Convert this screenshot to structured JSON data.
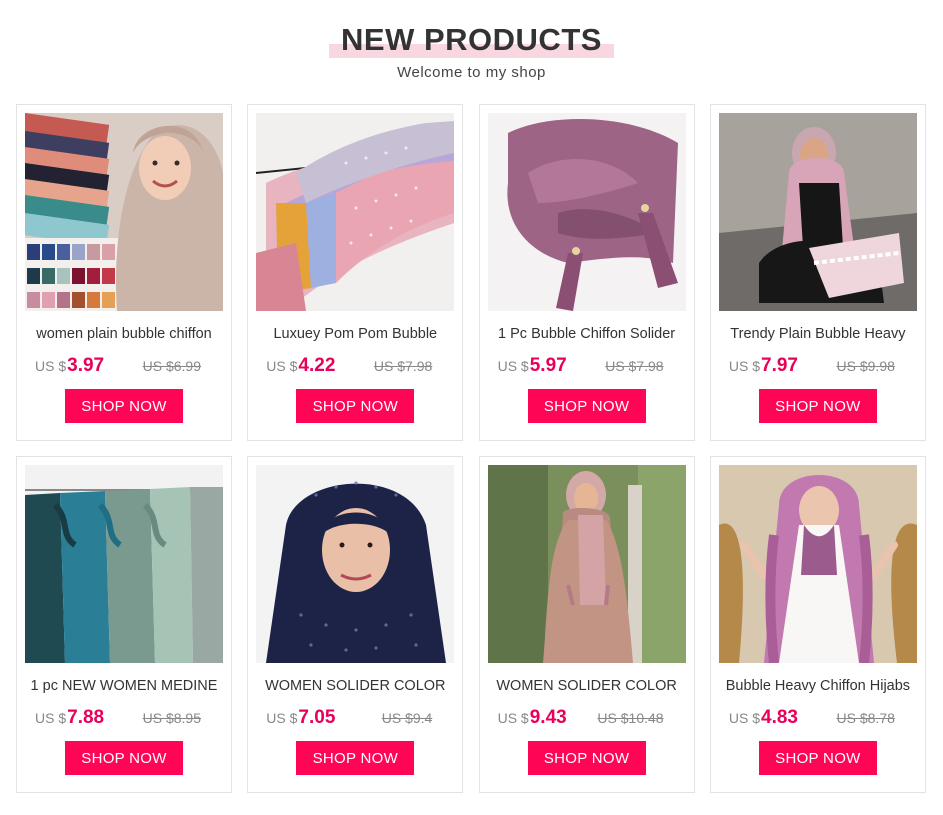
{
  "header": {
    "title": "NEW PRODUCTS",
    "subtitle": "Welcome to my shop"
  },
  "colors": {
    "accent": "#ff0556",
    "price": "#e8005a",
    "title_highlight": "#f8d7e0"
  },
  "products": [
    {
      "name": "women plain bubble chiffon",
      "currency": "US $",
      "price": "3.97",
      "old_price": "US $6.99",
      "button": "SHOP NOW",
      "image": "hijab-model-scarf-colors"
    },
    {
      "name": "Luxuey Pom Pom Bubble",
      "currency": "US $",
      "price": "4.22",
      "old_price": "US $7.98",
      "button": "SHOP NOW",
      "image": "pom-pom-scarves-hanging"
    },
    {
      "name": "1 Pc Bubble Chiffon Solider",
      "currency": "US $",
      "price": "5.97",
      "old_price": "US $7.98",
      "button": "SHOP NOW",
      "image": "purple-scarf-tassel"
    },
    {
      "name": "Trendy Plain Bubble Heavy",
      "currency": "US $",
      "price": "7.97",
      "old_price": "US $9.98",
      "button": "SHOP NOW",
      "image": "model-pink-lace-hijab"
    },
    {
      "name": "1 pc NEW WOMEN MEDINE",
      "currency": "US $",
      "price": "7.88",
      "old_price": "US $8.95",
      "button": "SHOP NOW",
      "image": "satin-scarves-hanging"
    },
    {
      "name": "WOMEN SOLIDER COLOR",
      "currency": "US $",
      "price": "7.05",
      "old_price": "US $9.4",
      "button": "SHOP NOW",
      "image": "navy-rhinestone-hijab"
    },
    {
      "name": "WOMEN SOLIDER COLOR",
      "currency": "US $",
      "price": "9.43",
      "old_price": "US $10.48",
      "button": "SHOP NOW",
      "image": "pink-tassel-hijab-model"
    },
    {
      "name": "Bubble Heavy Chiffon Hijabs",
      "currency": "US $",
      "price": "4.83",
      "old_price": "US $8.78",
      "button": "SHOP NOW",
      "image": "purple-embroidered-hijab-model"
    }
  ]
}
